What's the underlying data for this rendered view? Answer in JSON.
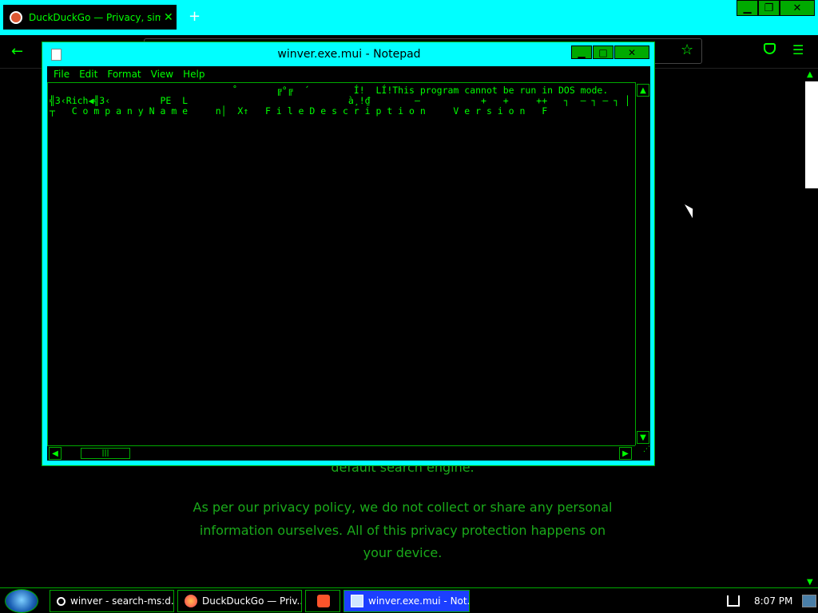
{
  "browser": {
    "tab_title": "DuckDuckGo — Privacy, simplif",
    "tab_close": "✕",
    "new_tab": "+",
    "back": "←",
    "star": "☆",
    "menu": "☰",
    "window_controls": {
      "minimize": "▁",
      "restore": "❐",
      "close": "✕"
    }
  },
  "page": {
    "partial_line": "default search engine.",
    "paragraph_lines": [
      "As per our privacy policy, we do not collect or share any personal",
      "information ourselves. All of this privacy protection happens on",
      "your device."
    ],
    "scroll_up": "▲",
    "scroll_down": "▼"
  },
  "notepad": {
    "title": "winver.exe.mui - Notepad",
    "controls": {
      "minimize": "▁",
      "maximize": "□",
      "close": "✕"
    },
    "menu": [
      "File",
      "Edit",
      "Format",
      "View",
      "Help"
    ],
    "content_lines": [
      "                                 ˚       ╔°╔  ´        Í!  LÍ!This program cannot be run in DOS mode.",
      "╣3‹Rich◀╣3‹         PE  L                             à¸!₫        –           +   +     ++   ┐  – ┐ – ┐ │",
      "┬   C o m p a n y N a m e     n│  X↑   F i l e D e s c r i p t i o n     V e r s i o n   F"
    ],
    "vscroll_up": "▲",
    "vscroll_down": "▼",
    "hscroll_left": "◀",
    "hscroll_right": "▶",
    "hthumb": "|||",
    "grip": "⋰"
  },
  "taskbar": {
    "items": [
      "winver - search-ms:d...",
      "DuckDuckGo — Priv...",
      "",
      "winver.exe.mui - Not..."
    ],
    "clock": "8:07 PM"
  },
  "colors": {
    "accent": "#00ffff",
    "text_green": "#00ff00",
    "background": "#000000"
  }
}
